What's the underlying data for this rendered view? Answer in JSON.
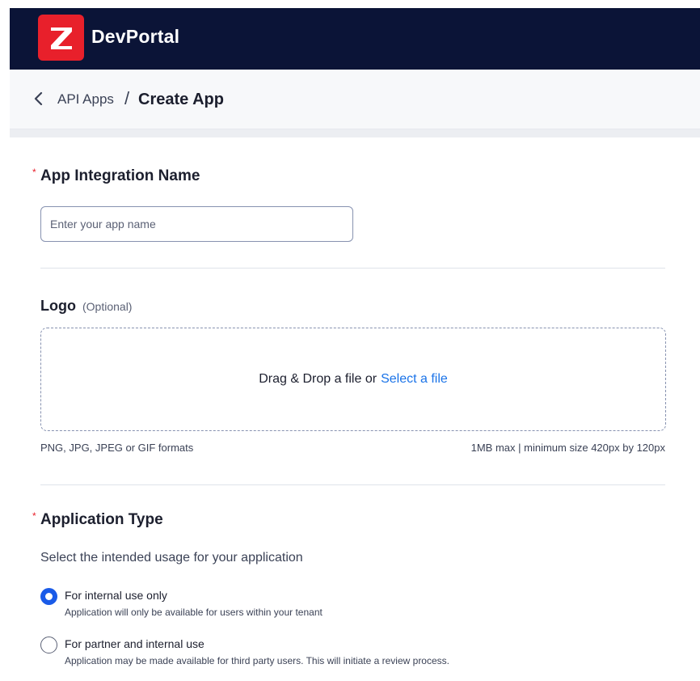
{
  "header": {
    "brand": "DevPortal",
    "logo_letter": "Z",
    "logo_color": "#e8202b",
    "bar_color": "#0b1437"
  },
  "breadcrumb": {
    "back_icon": "chevron-left-icon",
    "parent": "API Apps",
    "separator": "/",
    "current": "Create App"
  },
  "form": {
    "app_name": {
      "required_mark": "*",
      "label": "App Integration Name",
      "placeholder": "Enter your app name",
      "value": ""
    },
    "logo": {
      "label": "Logo",
      "optional": "(Optional)",
      "drop_text": "Drag & Drop a file or",
      "select_link": "Select a file",
      "formats": "PNG, JPG, JPEG or GIF formats",
      "limits": "1MB max | minimum size 420px by 120px"
    },
    "app_type": {
      "required_mark": "*",
      "label": "Application Type",
      "subtitle": "Select the intended usage for your application",
      "options": [
        {
          "label": "For internal use only",
          "description": "Application will only be available for users within your tenant",
          "selected": true
        },
        {
          "label": "For partner and internal use",
          "description": "Application may be made available for third party users. This will initiate a review process.",
          "selected": false
        }
      ]
    }
  },
  "colors": {
    "accent": "#1a5be8",
    "link": "#1a73e8",
    "required": "#e8202b"
  }
}
